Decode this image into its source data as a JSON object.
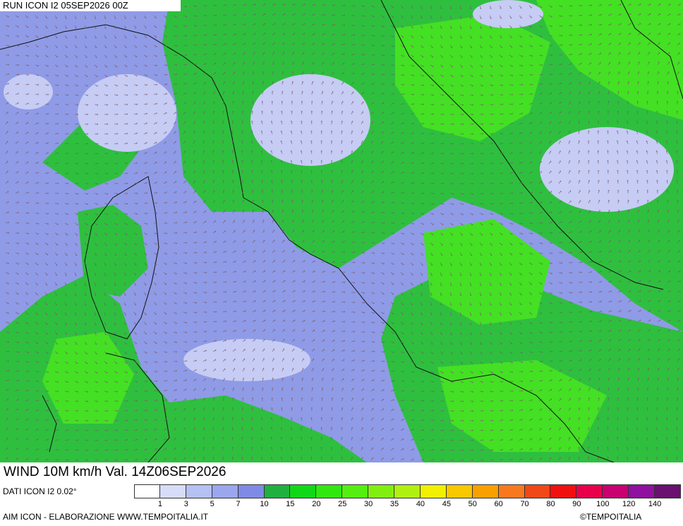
{
  "header": {
    "run_label": "RUN ICON I2 05SEP2026 00Z"
  },
  "variable": {
    "label": "WIND 10M km/h Val. 14Z06SEP2026"
  },
  "source": {
    "label": "DATI ICON I2 0.02°"
  },
  "footer": {
    "left": "AIM ICON - ELABORAZIONE WWW.TEMPOITALIA.IT",
    "right": "©TEMPOITALIA"
  },
  "legend": {
    "colors": [
      "#ffffff",
      "#d7dcf8",
      "#b5c0f3",
      "#9aa6ee",
      "#7f8ae6",
      "#20b040",
      "#10d818",
      "#30e810",
      "#55ee10",
      "#80ef10",
      "#b0f010",
      "#f0f000",
      "#f8c800",
      "#f8a000",
      "#f87820",
      "#f04818",
      "#f01010",
      "#e8004a",
      "#c80070",
      "#9010a0",
      "#6a1070"
    ],
    "ticks": [
      "1",
      "3",
      "5",
      "7",
      "10",
      "15",
      "20",
      "25",
      "30",
      "35",
      "40",
      "45",
      "50",
      "60",
      "70",
      "80",
      "90",
      "100",
      "120",
      "140"
    ]
  },
  "map": {
    "colors": {
      "calm": "#8f9be6",
      "light": "#c8cdf5",
      "moderate": "#30c040",
      "strong": "#40e020",
      "coast": "#101010",
      "arrow": "#7a5a6a"
    }
  }
}
